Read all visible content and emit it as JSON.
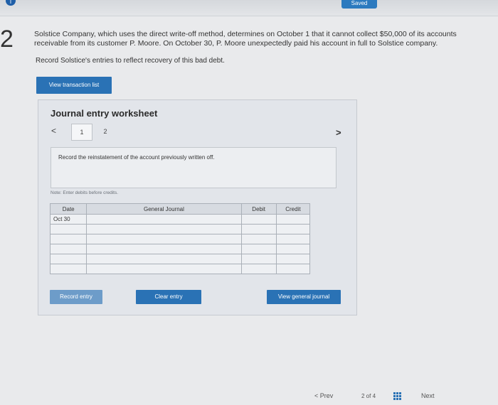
{
  "header": {
    "info_icon": "info-icon",
    "saved_label": "Saved"
  },
  "question": {
    "number": "2",
    "prompt": "Solstice Company, which uses the direct write-off method, determines on October 1 that it cannot collect $50,000 of its accounts receivable from its customer P. Moore. On October 30, P. Moore unexpectedly paid his account in full to Solstice company.",
    "instruction": "Record Solstice's entries to reflect recovery of this bad debt."
  },
  "buttons": {
    "view_transactions": "View transaction list",
    "record_entry": "Record entry",
    "clear_entry": "Clear entry",
    "view_general_journal": "View general journal"
  },
  "worksheet": {
    "title": "Journal entry worksheet",
    "prev_glyph": "<",
    "next_glyph": ">",
    "tabs": [
      "1",
      "2"
    ],
    "description": "Record the reinstatement of the account previously written off.",
    "note": "Note: Enter debits before credits."
  },
  "journal": {
    "headers": {
      "date": "Date",
      "general_journal": "General Journal",
      "debit": "Debit",
      "credit": "Credit"
    },
    "rows": [
      {
        "date": "Oct 30",
        "account": "",
        "debit": "",
        "credit": ""
      },
      {
        "date": "",
        "account": "",
        "debit": "",
        "credit": ""
      },
      {
        "date": "",
        "account": "",
        "debit": "",
        "credit": ""
      },
      {
        "date": "",
        "account": "",
        "debit": "",
        "credit": ""
      },
      {
        "date": "",
        "account": "",
        "debit": "",
        "credit": ""
      },
      {
        "date": "",
        "account": "",
        "debit": "",
        "credit": ""
      }
    ]
  },
  "footer": {
    "prev_label": "Prev",
    "prev_glyph": "<",
    "page_status": "2 of 4",
    "next_label": "Next",
    "grid_icon": "grid-icon"
  },
  "colors": {
    "accent": "#2a72b5",
    "background": "#e9eaec"
  }
}
